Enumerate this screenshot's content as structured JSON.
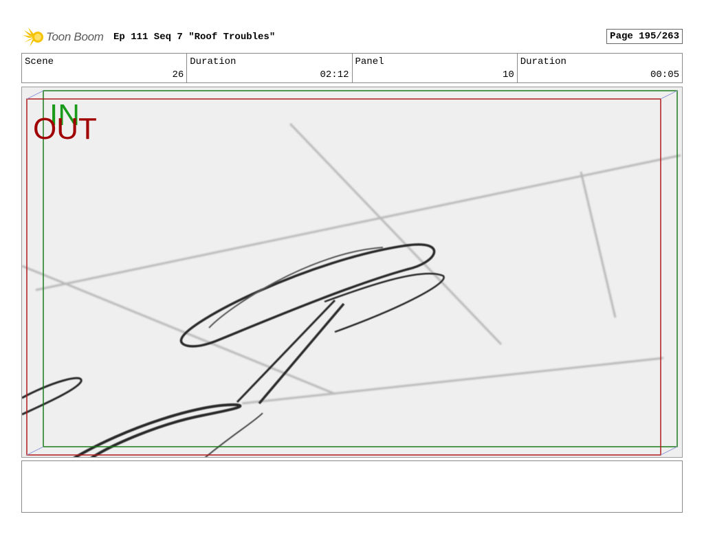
{
  "header": {
    "logo_text": "Toon Boom",
    "title": "Ep 111 Seq 7 \"Roof Troubles\"",
    "page": "Page 195/263"
  },
  "info": {
    "scene_label": "Scene",
    "scene_value": "26",
    "duration_label": "Duration",
    "duration_value": "02:12",
    "panel_label": "Panel",
    "panel_value": "10",
    "panel_duration_label": "Duration",
    "panel_duration_value": "00:05"
  },
  "frame": {
    "in_label": "IN",
    "out_label": "OUT",
    "in_color": "#1a9a1a",
    "out_color": "#a00000"
  },
  "notes": {
    "text": ""
  }
}
